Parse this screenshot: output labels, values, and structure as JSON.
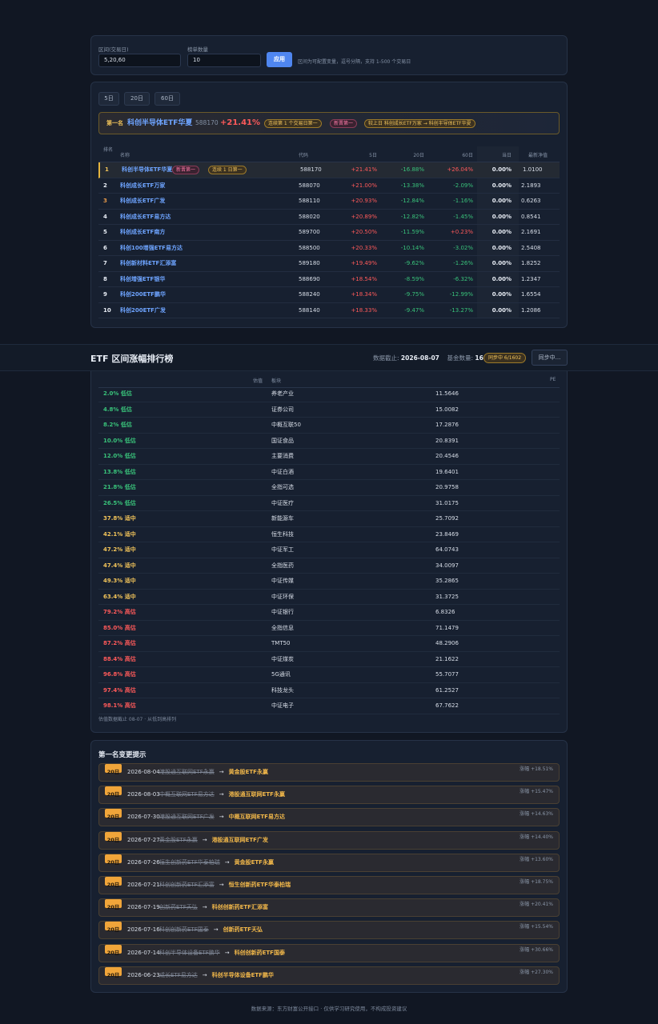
{
  "controls": {
    "range_label": "区间(交易日)",
    "range_value": "5,20,60",
    "count_label": "榜单数量",
    "count_value": "10",
    "apply_label": "应用",
    "hint": "区间为可配置变量，逗号分隔，支持 1-500 个交易日"
  },
  "period_tabs": [
    "5日",
    "20日",
    "60日"
  ],
  "leader": {
    "prefix": "第一名",
    "name": "科创半导体ETF华夏",
    "code": "588170",
    "pct": "+21.41%",
    "badge1": "连续第 1 个交易日第一",
    "badge2": "新晋第一",
    "badge3": "较上日 科创成长ETF万家 → 科创半导体ETF华夏"
  },
  "ranking": {
    "headers": {
      "rank": "排名",
      "name": "名称",
      "code": "代码",
      "d5": "5日",
      "d20": "20日",
      "d60": "60日",
      "today": "当日",
      "nav": "最新净值"
    },
    "top_badge1": "新晋第一",
    "top_badge2": "连续 1 日第一",
    "rows": [
      {
        "rank": "1",
        "name": "科创半导体ETF华夏",
        "code": "588170",
        "d5": "+21.41%",
        "d20": "-16.88%",
        "d60": "+26.04%",
        "today": "0.00%",
        "nav": "1.0100"
      },
      {
        "rank": "2",
        "name": "科创成长ETF万家",
        "code": "588070",
        "d5": "+21.00%",
        "d20": "-13.38%",
        "d60": "-2.09%",
        "today": "0.00%",
        "nav": "2.1893"
      },
      {
        "rank": "3",
        "name": "科创成长ETF广发",
        "code": "588110",
        "d5": "+20.93%",
        "d20": "-12.84%",
        "d60": "-1.16%",
        "today": "0.00%",
        "nav": "0.6263"
      },
      {
        "rank": "4",
        "name": "科创成长ETF易方达",
        "code": "588020",
        "d5": "+20.89%",
        "d20": "-12.82%",
        "d60": "-1.45%",
        "today": "0.00%",
        "nav": "0.8541"
      },
      {
        "rank": "5",
        "name": "科创成长ETF南方",
        "code": "589700",
        "d5": "+20.50%",
        "d20": "-11.59%",
        "d60": "+0.23%",
        "today": "0.00%",
        "nav": "2.1691"
      },
      {
        "rank": "6",
        "name": "科创100增强ETF易方达",
        "code": "588500",
        "d5": "+20.33%",
        "d20": "-10.14%",
        "d60": "-3.02%",
        "today": "0.00%",
        "nav": "2.5408"
      },
      {
        "rank": "7",
        "name": "科创新材料ETF汇添富",
        "code": "589180",
        "d5": "+19.49%",
        "d20": "-9.62%",
        "d60": "-1.26%",
        "today": "0.00%",
        "nav": "1.8252"
      },
      {
        "rank": "8",
        "name": "科创增强ETF银华",
        "code": "588690",
        "d5": "+18.54%",
        "d20": "-8.59%",
        "d60": "-6.32%",
        "today": "0.00%",
        "nav": "1.2347"
      },
      {
        "rank": "9",
        "name": "科创200ETF鹏华",
        "code": "588240",
        "d5": "+18.34%",
        "d20": "-9.75%",
        "d60": "-12.99%",
        "today": "0.00%",
        "nav": "1.6554"
      },
      {
        "rank": "10",
        "name": "科创200ETF广发",
        "code": "588140",
        "d5": "+18.33%",
        "d20": "-9.47%",
        "d60": "-13.27%",
        "today": "0.00%",
        "nav": "1.2086"
      }
    ]
  },
  "sticky": {
    "title": "ETF 区间涨幅排行榜",
    "date_label": "数据截止:",
    "date_value": "2026-08-07",
    "count_label": "基金数量:",
    "count_value": "1602",
    "sync_badge": "同步中 6/1602",
    "sync_button": "同步中..."
  },
  "valuation": {
    "headers": {
      "pct": "估值",
      "sector": "板块",
      "pe": "PE"
    },
    "rows": [
      {
        "pct": "2.0% 低估",
        "level": "low",
        "sector": "养老产业",
        "pe": "11.5646"
      },
      {
        "pct": "4.8% 低估",
        "level": "low",
        "sector": "证券公司",
        "pe": "15.0082"
      },
      {
        "pct": "8.2% 低估",
        "level": "low",
        "sector": "中概互联50",
        "pe": "17.2876"
      },
      {
        "pct": "10.0% 低估",
        "level": "low",
        "sector": "国证食品",
        "pe": "20.8391"
      },
      {
        "pct": "12.0% 低估",
        "level": "low",
        "sector": "主要消费",
        "pe": "20.4546"
      },
      {
        "pct": "13.8% 低估",
        "level": "low",
        "sector": "中证白酒",
        "pe": "19.6401"
      },
      {
        "pct": "21.8% 低估",
        "level": "low",
        "sector": "全指可选",
        "pe": "20.9758"
      },
      {
        "pct": "26.5% 低估",
        "level": "low",
        "sector": "中证医疗",
        "pe": "31.0175"
      },
      {
        "pct": "37.8% 适中",
        "level": "mid",
        "sector": "新能源车",
        "pe": "25.7092"
      },
      {
        "pct": "42.1% 适中",
        "level": "mid",
        "sector": "恒生科技",
        "pe": "23.8469"
      },
      {
        "pct": "47.2% 适中",
        "level": "mid",
        "sector": "中证军工",
        "pe": "64.0743"
      },
      {
        "pct": "47.4% 适中",
        "level": "mid",
        "sector": "全指医药",
        "pe": "34.0097"
      },
      {
        "pct": "49.3% 适中",
        "level": "mid",
        "sector": "中证传媒",
        "pe": "35.2865"
      },
      {
        "pct": "63.4% 适中",
        "level": "mid",
        "sector": "中证环保",
        "pe": "31.3725"
      },
      {
        "pct": "79.2% 高估",
        "level": "high",
        "sector": "中证银行",
        "pe": "6.8326"
      },
      {
        "pct": "85.0% 高估",
        "level": "high",
        "sector": "全指信息",
        "pe": "71.1479"
      },
      {
        "pct": "87.2% 高估",
        "level": "high",
        "sector": "TMT50",
        "pe": "48.2906"
      },
      {
        "pct": "88.4% 高估",
        "level": "high",
        "sector": "中证煤炭",
        "pe": "21.1622"
      },
      {
        "pct": "96.8% 高估",
        "level": "high",
        "sector": "5G通讯",
        "pe": "55.7077"
      },
      {
        "pct": "97.4% 高估",
        "level": "high",
        "sector": "科技龙头",
        "pe": "61.2527"
      },
      {
        "pct": "98.1% 高估",
        "level": "high",
        "sector": "中证电子",
        "pe": "67.7622"
      }
    ],
    "note": "估值数据截止 08-07 · 从低到高排列"
  },
  "changes": {
    "title": "第一名变更提示",
    "arrow": "→",
    "rows": [
      {
        "tag": "20日",
        "date": "2026-08-04",
        "from": "港股通互联网ETF永赢",
        "to": "黄金股ETF永赢",
        "gain": "涨幅 +18.51%"
      },
      {
        "tag": "20日",
        "date": "2026-08-03",
        "from": "中概互联网ETF易方达",
        "to": "港股通互联网ETF永赢",
        "gain": "涨幅 +15.47%"
      },
      {
        "tag": "20日",
        "date": "2026-07-30",
        "from": "港股通互联网ETF广发",
        "to": "中概互联网ETF易方达",
        "gain": "涨幅 +14.63%"
      },
      {
        "tag": "20日",
        "date": "2026-07-27",
        "from": "黄金股ETF永赢",
        "to": "港股通互联网ETF广发",
        "gain": "涨幅 +14.40%"
      },
      {
        "tag": "20日",
        "date": "2026-07-26",
        "from": "恒生创新药ETF华泰柏瑞",
        "to": "黄金股ETF永赢",
        "gain": "涨幅 +13.60%"
      },
      {
        "tag": "20日",
        "date": "2026-07-21",
        "from": "科创创新药ETF汇添富",
        "to": "恒生创新药ETF华泰柏瑞",
        "gain": "涨幅 +18.75%"
      },
      {
        "tag": "20日",
        "date": "2026-07-19",
        "from": "创新药ETF天弘",
        "to": "科创创新药ETF汇添富",
        "gain": "涨幅 +20.41%"
      },
      {
        "tag": "20日",
        "date": "2026-07-16",
        "from": "科创创新药ETF国泰",
        "to": "创新药ETF天弘",
        "gain": "涨幅 +15.54%"
      },
      {
        "tag": "20日",
        "date": "2026-07-14",
        "from": "科创半导体设备ETF鹏华",
        "to": "科创创新药ETF国泰",
        "gain": "涨幅 +30.66%"
      },
      {
        "tag": "20日",
        "date": "2026-06-23",
        "from": "成长ETF易方达",
        "to": "科创半导体设备ETF鹏华",
        "gain": "涨幅 +27.30%"
      }
    ]
  },
  "footer": "数据来源：东方财富公开接口 · 仅供学习研究使用，不构成投资建议",
  "colors": {
    "up": "#ff5a5a",
    "down": "#39c27a",
    "low": "#39c27a",
    "mid": "#f2c45a",
    "high": "#ff5a5a",
    "accent": "#4f86f0"
  }
}
